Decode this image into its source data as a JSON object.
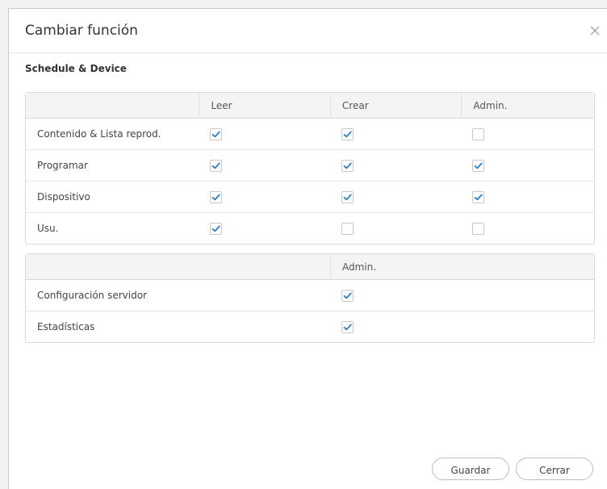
{
  "dialog": {
    "title": "Cambiar función",
    "section_title": "Schedule & Device"
  },
  "table1": {
    "headers": [
      "",
      "Leer",
      "Crear",
      "Admin."
    ],
    "rows": [
      {
        "label": "Contenido & Lista reprod.",
        "read": true,
        "create": true,
        "admin": false
      },
      {
        "label": "Programar",
        "read": true,
        "create": true,
        "admin": true
      },
      {
        "label": "Dispositivo",
        "read": true,
        "create": true,
        "admin": true
      },
      {
        "label": "Usu.",
        "read": true,
        "create": false,
        "admin": false
      }
    ]
  },
  "table2": {
    "headers": [
      "",
      "Admin."
    ],
    "rows": [
      {
        "label": "Configuración servidor",
        "admin": true
      },
      {
        "label": "Estadísticas",
        "admin": true
      }
    ]
  },
  "buttons": {
    "save": "Guardar",
    "cancel": "Cerrar"
  },
  "colors": {
    "check": "#2f7fc6"
  },
  "icons": {
    "close": "close-icon",
    "check": "check-icon"
  }
}
